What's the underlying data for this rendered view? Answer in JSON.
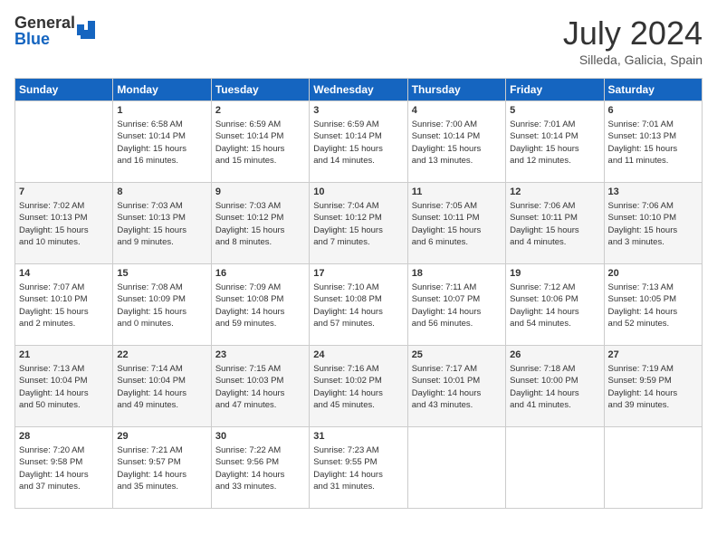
{
  "header": {
    "logo_general": "General",
    "logo_blue": "Blue",
    "month": "July 2024",
    "location": "Silleda, Galicia, Spain"
  },
  "weekdays": [
    "Sunday",
    "Monday",
    "Tuesday",
    "Wednesday",
    "Thursday",
    "Friday",
    "Saturday"
  ],
  "weeks": [
    [
      {
        "day": "",
        "info": ""
      },
      {
        "day": "1",
        "info": "Sunrise: 6:58 AM\nSunset: 10:14 PM\nDaylight: 15 hours\nand 16 minutes."
      },
      {
        "day": "2",
        "info": "Sunrise: 6:59 AM\nSunset: 10:14 PM\nDaylight: 15 hours\nand 15 minutes."
      },
      {
        "day": "3",
        "info": "Sunrise: 6:59 AM\nSunset: 10:14 PM\nDaylight: 15 hours\nand 14 minutes."
      },
      {
        "day": "4",
        "info": "Sunrise: 7:00 AM\nSunset: 10:14 PM\nDaylight: 15 hours\nand 13 minutes."
      },
      {
        "day": "5",
        "info": "Sunrise: 7:01 AM\nSunset: 10:14 PM\nDaylight: 15 hours\nand 12 minutes."
      },
      {
        "day": "6",
        "info": "Sunrise: 7:01 AM\nSunset: 10:13 PM\nDaylight: 15 hours\nand 11 minutes."
      }
    ],
    [
      {
        "day": "7",
        "info": "Sunrise: 7:02 AM\nSunset: 10:13 PM\nDaylight: 15 hours\nand 10 minutes."
      },
      {
        "day": "8",
        "info": "Sunrise: 7:03 AM\nSunset: 10:13 PM\nDaylight: 15 hours\nand 9 minutes."
      },
      {
        "day": "9",
        "info": "Sunrise: 7:03 AM\nSunset: 10:12 PM\nDaylight: 15 hours\nand 8 minutes."
      },
      {
        "day": "10",
        "info": "Sunrise: 7:04 AM\nSunset: 10:12 PM\nDaylight: 15 hours\nand 7 minutes."
      },
      {
        "day": "11",
        "info": "Sunrise: 7:05 AM\nSunset: 10:11 PM\nDaylight: 15 hours\nand 6 minutes."
      },
      {
        "day": "12",
        "info": "Sunrise: 7:06 AM\nSunset: 10:11 PM\nDaylight: 15 hours\nand 4 minutes."
      },
      {
        "day": "13",
        "info": "Sunrise: 7:06 AM\nSunset: 10:10 PM\nDaylight: 15 hours\nand 3 minutes."
      }
    ],
    [
      {
        "day": "14",
        "info": "Sunrise: 7:07 AM\nSunset: 10:10 PM\nDaylight: 15 hours\nand 2 minutes."
      },
      {
        "day": "15",
        "info": "Sunrise: 7:08 AM\nSunset: 10:09 PM\nDaylight: 15 hours\nand 0 minutes."
      },
      {
        "day": "16",
        "info": "Sunrise: 7:09 AM\nSunset: 10:08 PM\nDaylight: 14 hours\nand 59 minutes."
      },
      {
        "day": "17",
        "info": "Sunrise: 7:10 AM\nSunset: 10:08 PM\nDaylight: 14 hours\nand 57 minutes."
      },
      {
        "day": "18",
        "info": "Sunrise: 7:11 AM\nSunset: 10:07 PM\nDaylight: 14 hours\nand 56 minutes."
      },
      {
        "day": "19",
        "info": "Sunrise: 7:12 AM\nSunset: 10:06 PM\nDaylight: 14 hours\nand 54 minutes."
      },
      {
        "day": "20",
        "info": "Sunrise: 7:13 AM\nSunset: 10:05 PM\nDaylight: 14 hours\nand 52 minutes."
      }
    ],
    [
      {
        "day": "21",
        "info": "Sunrise: 7:13 AM\nSunset: 10:04 PM\nDaylight: 14 hours\nand 50 minutes."
      },
      {
        "day": "22",
        "info": "Sunrise: 7:14 AM\nSunset: 10:04 PM\nDaylight: 14 hours\nand 49 minutes."
      },
      {
        "day": "23",
        "info": "Sunrise: 7:15 AM\nSunset: 10:03 PM\nDaylight: 14 hours\nand 47 minutes."
      },
      {
        "day": "24",
        "info": "Sunrise: 7:16 AM\nSunset: 10:02 PM\nDaylight: 14 hours\nand 45 minutes."
      },
      {
        "day": "25",
        "info": "Sunrise: 7:17 AM\nSunset: 10:01 PM\nDaylight: 14 hours\nand 43 minutes."
      },
      {
        "day": "26",
        "info": "Sunrise: 7:18 AM\nSunset: 10:00 PM\nDaylight: 14 hours\nand 41 minutes."
      },
      {
        "day": "27",
        "info": "Sunrise: 7:19 AM\nSunset: 9:59 PM\nDaylight: 14 hours\nand 39 minutes."
      }
    ],
    [
      {
        "day": "28",
        "info": "Sunrise: 7:20 AM\nSunset: 9:58 PM\nDaylight: 14 hours\nand 37 minutes."
      },
      {
        "day": "29",
        "info": "Sunrise: 7:21 AM\nSunset: 9:57 PM\nDaylight: 14 hours\nand 35 minutes."
      },
      {
        "day": "30",
        "info": "Sunrise: 7:22 AM\nSunset: 9:56 PM\nDaylight: 14 hours\nand 33 minutes."
      },
      {
        "day": "31",
        "info": "Sunrise: 7:23 AM\nSunset: 9:55 PM\nDaylight: 14 hours\nand 31 minutes."
      },
      {
        "day": "",
        "info": ""
      },
      {
        "day": "",
        "info": ""
      },
      {
        "day": "",
        "info": ""
      }
    ]
  ]
}
